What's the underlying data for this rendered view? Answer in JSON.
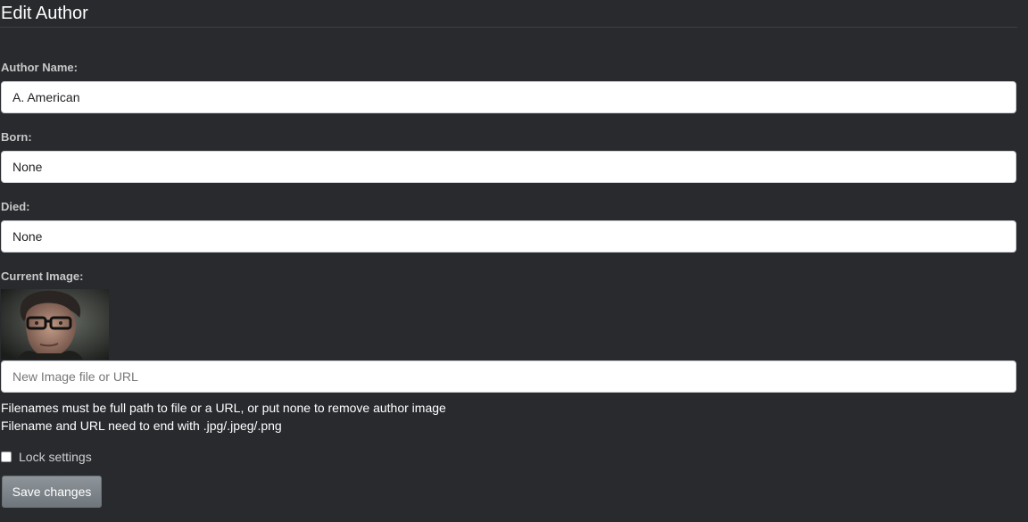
{
  "header": {
    "title": "Edit Author"
  },
  "form": {
    "author_name": {
      "label": "Author Name:",
      "value": "A. American"
    },
    "born": {
      "label": "Born:",
      "value": "None"
    },
    "died": {
      "label": "Died:",
      "value": "None"
    },
    "image": {
      "label": "Current Image:",
      "placeholder": "New Image file or URL",
      "value": "",
      "help_lines": [
        "Filenames must be full path to file or a URL, or put none to remove author image",
        "Filename and URL need to end with .jpg/.jpeg/.png"
      ]
    },
    "lock": {
      "label": "Lock settings",
      "checked": false
    },
    "save_label": "Save changes"
  },
  "colors": {
    "background": "#282a2e",
    "input_background": "#ffffff",
    "button": "#7b8389"
  },
  "icons": {
    "author_image": "author-portrait-image"
  }
}
